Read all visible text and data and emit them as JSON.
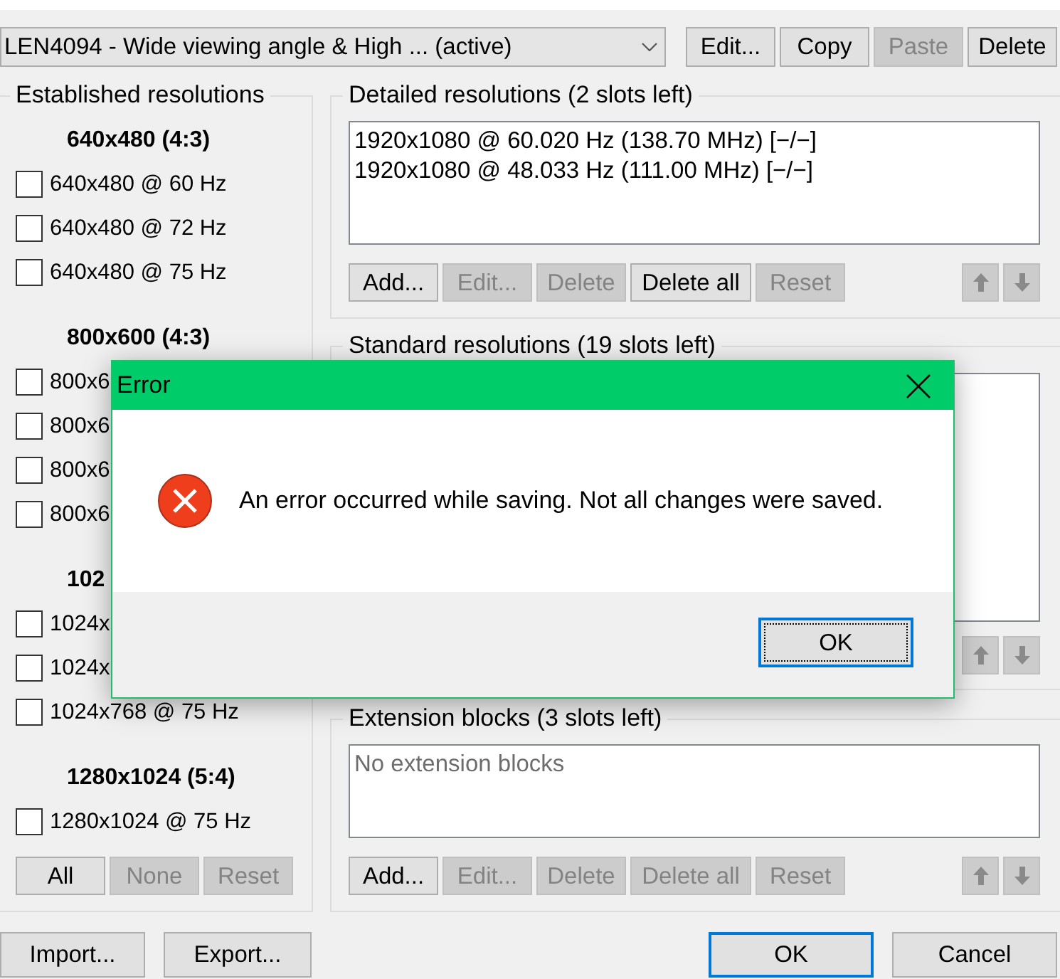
{
  "profile_select": {
    "value": "LEN4094 - Wide viewing angle & High ... (active)"
  },
  "profile_buttons": [
    {
      "label": "Edit...",
      "disabled": false
    },
    {
      "label": "Copy",
      "disabled": false
    },
    {
      "label": "Paste",
      "disabled": true
    },
    {
      "label": "Delete",
      "disabled": false
    }
  ],
  "established_resolutions": {
    "title": "Established resolutions",
    "groups": [
      {
        "heading": "640x480 (4:3)",
        "items": [
          {
            "label": "640x480 @ 60 Hz",
            "checked": false
          },
          {
            "label": "640x480 @ 72 Hz",
            "checked": false
          },
          {
            "label": "640x480 @ 75 Hz",
            "checked": false
          }
        ]
      },
      {
        "heading": "800x600 (4:3)",
        "items": [
          {
            "label": "800x6",
            "checked": false
          },
          {
            "label": "800x6",
            "checked": false
          },
          {
            "label": "800x6",
            "checked": false
          },
          {
            "label": "800x6",
            "checked": false
          }
        ]
      },
      {
        "heading": "102",
        "items": [
          {
            "label": "1024x",
            "checked": false
          },
          {
            "label": "1024x",
            "checked": false
          },
          {
            "label": "1024x768 @ 75 Hz",
            "checked": false
          }
        ]
      },
      {
        "heading": "1280x1024 (5:4)",
        "items": [
          {
            "label": "1280x1024 @ 75 Hz",
            "checked": false
          }
        ]
      }
    ],
    "buttons": [
      {
        "label": "All",
        "disabled": false
      },
      {
        "label": "None",
        "disabled": true
      },
      {
        "label": "Reset",
        "disabled": true
      }
    ]
  },
  "detailed_resolutions": {
    "title": "Detailed resolutions (2 slots left)",
    "items": [
      {
        "label": "1920x1080 @ 60.020 Hz (138.70 MHz) [−/−]",
        "selected": false
      },
      {
        "label": "1920x1080 @ 48.033 Hz (111.00 MHz) [−/−]",
        "selected": false
      }
    ],
    "buttons": [
      {
        "label": "Add...",
        "disabled": false
      },
      {
        "label": "Edit...",
        "disabled": true
      },
      {
        "label": "Delete",
        "disabled": true
      },
      {
        "label": "Delete all",
        "disabled": false
      },
      {
        "label": "Reset",
        "disabled": true
      }
    ],
    "arrows": [
      {
        "kind": "up",
        "disabled": true
      },
      {
        "kind": "down",
        "disabled": true
      }
    ]
  },
  "standard_resolutions": {
    "title": "Standard resolutions (19 slots left)",
    "arrows": [
      {
        "kind": "up",
        "disabled": true
      },
      {
        "kind": "down",
        "disabled": true
      }
    ]
  },
  "extension_blocks": {
    "title": "Extension blocks (3 slots left)",
    "empty_text": "No extension blocks",
    "buttons": [
      {
        "label": "Add...",
        "disabled": false
      },
      {
        "label": "Edit...",
        "disabled": true
      },
      {
        "label": "Delete",
        "disabled": true
      },
      {
        "label": "Delete all",
        "disabled": true
      },
      {
        "label": "Reset",
        "disabled": true
      }
    ],
    "arrows": [
      {
        "kind": "up",
        "disabled": true
      },
      {
        "kind": "down",
        "disabled": true
      }
    ]
  },
  "footer": {
    "left_buttons": [
      {
        "label": "Import..."
      },
      {
        "label": "Export..."
      }
    ],
    "right_buttons": [
      {
        "label": "OK",
        "default": true
      },
      {
        "label": "Cancel",
        "default": false
      }
    ]
  },
  "error_dialog": {
    "title": "Error",
    "message": "An error occurred while saving. Not all changes were saved.",
    "button": {
      "label": "OK",
      "default": true,
      "focused": true
    }
  }
}
